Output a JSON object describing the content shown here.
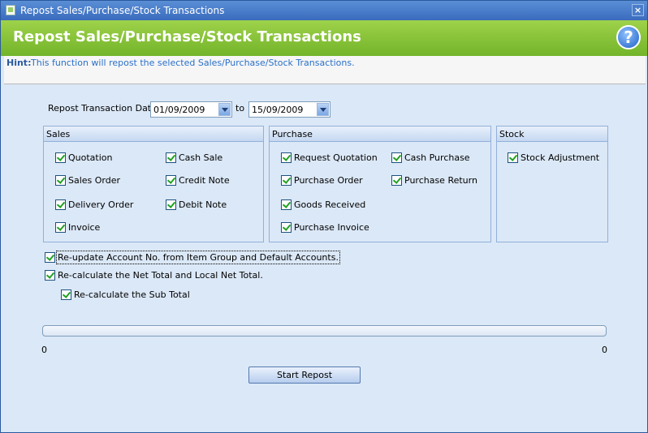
{
  "window": {
    "title": "Repost Sales/Purchase/Stock Transactions",
    "close_symbol": "×"
  },
  "banner": {
    "heading": "Repost Sales/Purchase/Stock Transactions",
    "help_symbol": "?"
  },
  "hint": {
    "label": "Hint:",
    "text": "This function will repost the selected Sales/Purchase/Stock Transactions."
  },
  "date_range": {
    "label": "Repost Transaction Date",
    "from": "01/09/2009",
    "to_label": "to",
    "to": "15/09/2009"
  },
  "groups": {
    "sales": {
      "title": "Sales",
      "items": [
        "Quotation",
        "Cash Sale",
        "Sales Order",
        "Credit Note",
        "Delivery Order",
        "Debit Note",
        "Invoice"
      ]
    },
    "purchase": {
      "title": "Purchase",
      "items": [
        "Request Quotation",
        "Cash Purchase",
        "Purchase Order",
        "Purchase Return",
        "Goods Received",
        "Purchase Invoice"
      ]
    },
    "stock": {
      "title": "Stock",
      "items": [
        "Stock Adjustment"
      ]
    }
  },
  "options": {
    "reupdate_account": "Re-update Account No. from Item Group and Default Accounts.",
    "recalc_net_total": "Re-calculate the Net Total and Local Net Total.",
    "recalc_sub_total": "Re-calculate the Sub Total"
  },
  "progress": {
    "min_label": "0",
    "max_label": "0",
    "fraction": 0
  },
  "start_button": "Start Repost",
  "colors": {
    "banner_green": "#8cc63f",
    "title_blue": "#3a6bbd",
    "background": "#dbe8f7",
    "hint_text": "#2a70c8"
  }
}
